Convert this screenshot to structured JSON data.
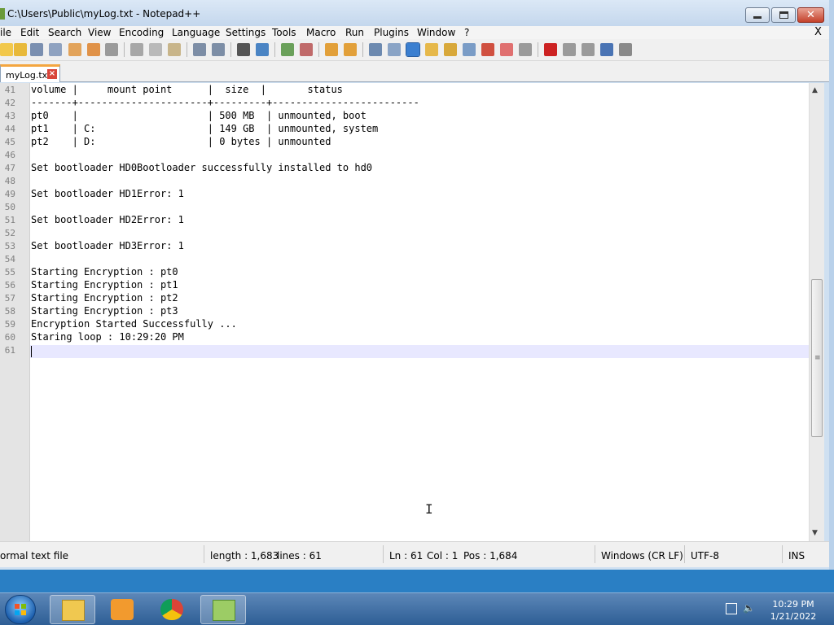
{
  "window": {
    "title": "C:\\Users\\Public\\myLog.txt - Notepad++",
    "minimize_icon": "minimize-icon",
    "maximize_icon": "maximize-icon",
    "close_icon": "close-icon"
  },
  "menu": {
    "items": [
      "ile",
      "Edit",
      "Search",
      "View",
      "Encoding",
      "Language",
      "Settings",
      "Tools",
      "Macro",
      "Run",
      "Plugins",
      "Window",
      "?"
    ],
    "close_doc": "X"
  },
  "toolbar": {
    "icons": [
      "new-icon",
      "open-icon",
      "save-icon",
      "save-all-icon",
      "close-icon",
      "close-all-icon",
      "print-icon",
      "cut-icon",
      "copy-icon",
      "paste-icon",
      "undo-icon",
      "redo-icon",
      "find-icon",
      "replace-icon",
      "zoom-in-icon",
      "zoom-out-icon",
      "sync-vertical-icon",
      "sync-horizontal-icon",
      "word-wrap-icon",
      "show-all-chars-icon",
      "indent-guide-icon",
      "doc-map-icon",
      "function-list-icon",
      "folder-workspace-icon",
      "monitor-icon",
      "record-macro-icon",
      "stop-macro-icon",
      "play-macro-icon",
      "run-macro-multiple-icon",
      "save-macro-icon"
    ],
    "colors": {
      "record": "#cc2222",
      "accent": "#3b7fd0"
    }
  },
  "tabs": [
    {
      "label": "myLog.txt",
      "close_icon": "tab-close-icon"
    }
  ],
  "editor": {
    "lines": [
      {
        "n": "41",
        "text": "volume |     mount point      |  size  |       status"
      },
      {
        "n": "42",
        "text": "-------+----------------------+---------+-------------------------"
      },
      {
        "n": "43",
        "text": "pt0    |                      | 500 MB  | unmounted, boot"
      },
      {
        "n": "44",
        "text": "pt1    | C:                   | 149 GB  | unmounted, system"
      },
      {
        "n": "45",
        "text": "pt2    | D:                   | 0 bytes | unmounted"
      },
      {
        "n": "46",
        "text": ""
      },
      {
        "n": "47",
        "text": "Set bootloader HD0Bootloader successfully installed to hd0"
      },
      {
        "n": "48",
        "text": ""
      },
      {
        "n": "49",
        "text": "Set bootloader HD1Error: 1"
      },
      {
        "n": "50",
        "text": ""
      },
      {
        "n": "51",
        "text": "Set bootloader HD2Error: 1"
      },
      {
        "n": "52",
        "text": ""
      },
      {
        "n": "53",
        "text": "Set bootloader HD3Error: 1"
      },
      {
        "n": "54",
        "text": ""
      },
      {
        "n": "55",
        "text": "Starting Encryption : pt0"
      },
      {
        "n": "56",
        "text": "Starting Encryption : pt1"
      },
      {
        "n": "57",
        "text": "Starting Encryption : pt2"
      },
      {
        "n": "58",
        "text": "Starting Encryption : pt3"
      },
      {
        "n": "59",
        "text": "Encryption Started Successfully ..."
      },
      {
        "n": "60",
        "text": "Staring loop : 10:29:20 PM"
      },
      {
        "n": "61",
        "text": ""
      }
    ],
    "current_line": "61"
  },
  "status": {
    "file_type": "ormal text file",
    "length": "length : 1,683",
    "lines": "lines : 61",
    "ln": "Ln : 61",
    "col": "Col : 1",
    "pos": "Pos : 1,684",
    "eol": "Windows (CR LF)",
    "encoding": "UTF-8",
    "mode": "INS"
  },
  "taskbar": {
    "apps": [
      "file-explorer-icon",
      "media-player-icon",
      "chrome-icon",
      "notepad-plus-plus-icon"
    ],
    "time": "10:29 PM",
    "date": "1/21/2022"
  }
}
